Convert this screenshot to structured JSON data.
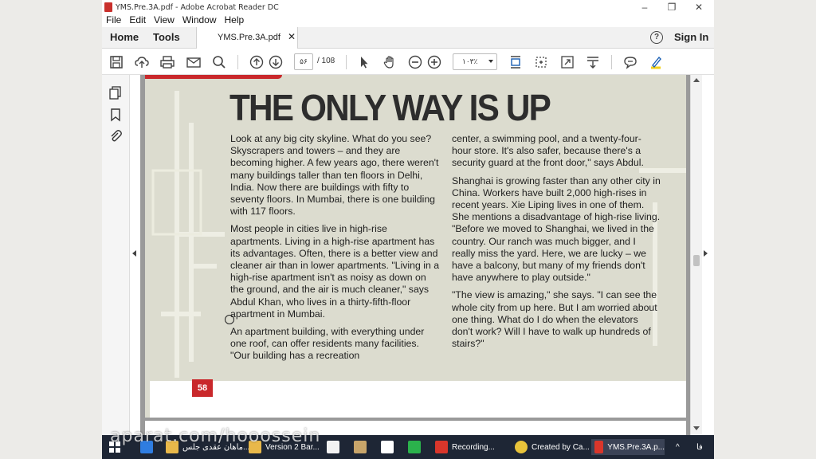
{
  "window": {
    "title": "YMS.Pre.3A.pdf - Adobe Acrobat Reader DC",
    "minimize": "–",
    "restore": "❐",
    "close": "✕"
  },
  "menu": [
    "File",
    "Edit",
    "View",
    "Window",
    "Help"
  ],
  "tabs": {
    "home": "Home",
    "tools": "Tools",
    "doc": "YMS.Pre.3A.pdf",
    "doc_close": "✕",
    "help": "?",
    "signin": "Sign In"
  },
  "toolbar": {
    "page_current": "۵۶",
    "page_total": "/ 108",
    "zoom": "۱۰۳٪"
  },
  "article": {
    "headline": "THE ONLY WAY IS UP",
    "col1": [
      "Look at any big city skyline. What do you see? Skyscrapers and towers – and they are becoming higher. A few years ago, there weren't many buildings taller than ten floors in Delhi, India. Now there are buildings with fifty to seventy floors. In Mumbai, there is one building with 117 floors.",
      "Most people in cities live in high-rise apartments. Living in a high-rise apartment has its advantages. Often, there is a better view and cleaner air than in lower apartments. \"Living in a high-rise apartment isn't as noisy as down on the ground, and the air is much cleaner,\" says Abdul Khan, who lives in a thirty-fifth-floor apartment in Mumbai.",
      "An apartment building, with everything under one roof, can offer residents many facilities. \"Our building has a recreation"
    ],
    "col2": [
      "center, a swimming pool, and a twenty-four-hour store. It's also safer, because there's a security guard at the front door,\" says Abdul.",
      "Shanghai is growing faster than any other city in China. Workers have built 2,000 high-rises in recent years. Xie Liping lives in one of them. She mentions a disadvantage of high-rise living. \"Before we moved to Shanghai, we lived in the country. Our ranch was much bigger, and I really miss the yard. Here, we are lucky – we have a balcony, but many of my friends don't have anywhere to play outside.\"",
      "\"The view is amazing,\" she says. \"I can see the whole city from up here. But I am worried about one thing. What do I do when the elevators don't work? Will I have to walk up hundreds of stairs?\""
    ],
    "page_number": "58"
  },
  "taskbar": {
    "items": [
      "ماهان عقدی جلس...",
      "Version 2 Bar...",
      "Recording...",
      "Created by Ca...",
      "YMS.Pre.3A.p..."
    ],
    "lang": "فا"
  },
  "watermark": "aparat.com/hooossein",
  "colors": {
    "accent_red": "#c9282b",
    "taskbar": "#1e2635"
  }
}
